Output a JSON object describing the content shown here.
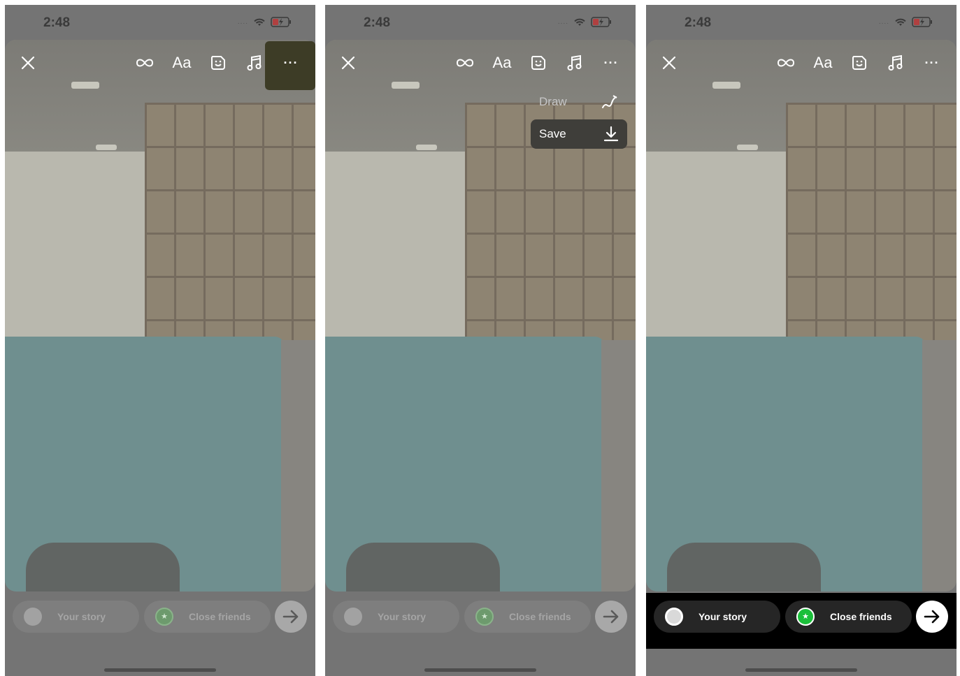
{
  "colors": {
    "overlay_dim": "#747474",
    "menu_highlight": "#3d3c26",
    "close_friends_green": "#1bbf3a",
    "bottom_bar_active": "#000000"
  },
  "panels": [
    {
      "status": {
        "time": "2:48"
      },
      "toolbar": {
        "text_tool_label": "Aa"
      },
      "bottom": {
        "your_story_label": "Your story",
        "close_friends_label": "Close friends"
      }
    },
    {
      "status": {
        "time": "2:48"
      },
      "toolbar": {
        "text_tool_label": "Aa"
      },
      "menu": {
        "draw_label": "Draw",
        "save_label": "Save"
      },
      "bottom": {
        "your_story_label": "Your story",
        "close_friends_label": "Close friends"
      }
    },
    {
      "status": {
        "time": "2:48"
      },
      "toolbar": {
        "text_tool_label": "Aa"
      },
      "bottom": {
        "your_story_label": "Your story",
        "close_friends_label": "Close friends"
      }
    }
  ],
  "icons": [
    "close-icon",
    "infinity-icon",
    "text-icon",
    "sticker-icon",
    "music-icon",
    "more-icon",
    "draw-icon",
    "download-icon",
    "star-icon",
    "arrow-right-icon",
    "wifi-icon",
    "battery-icon"
  ]
}
